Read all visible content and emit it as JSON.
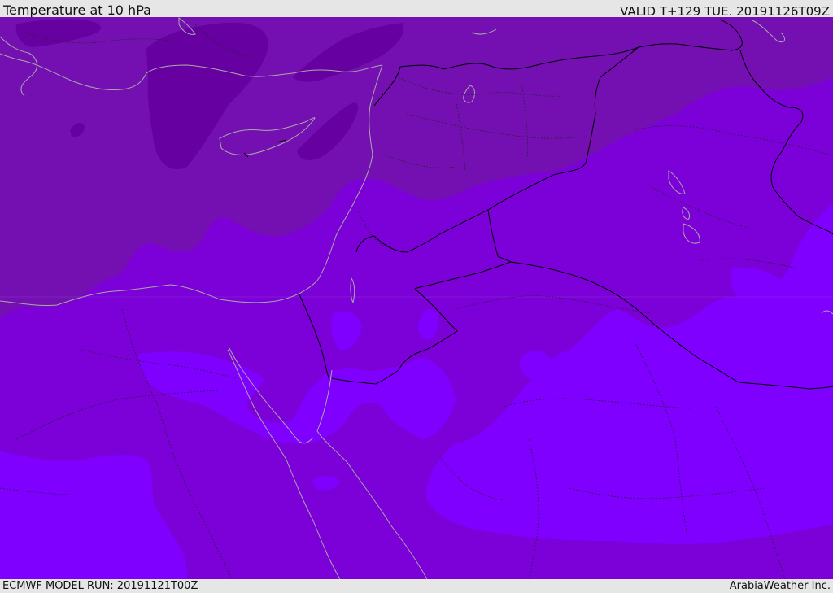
{
  "header": {
    "title": "Temperature at 10 hPa",
    "valid": "VALID T+129 TUE. 20191126T09Z"
  },
  "footer": {
    "model_run": "ECMWF MODEL RUN: 20191121T00Z",
    "credit": "ArabiaWeather Inc."
  },
  "colors": {
    "band_darkest": "#6700a0",
    "band_dark": "#7410b1",
    "band_mid": "#7c00d8",
    "band_light": "#8000ff",
    "coastline": "#a8a8a8",
    "border": "#000000",
    "header_bg": "#e6e6e6"
  }
}
